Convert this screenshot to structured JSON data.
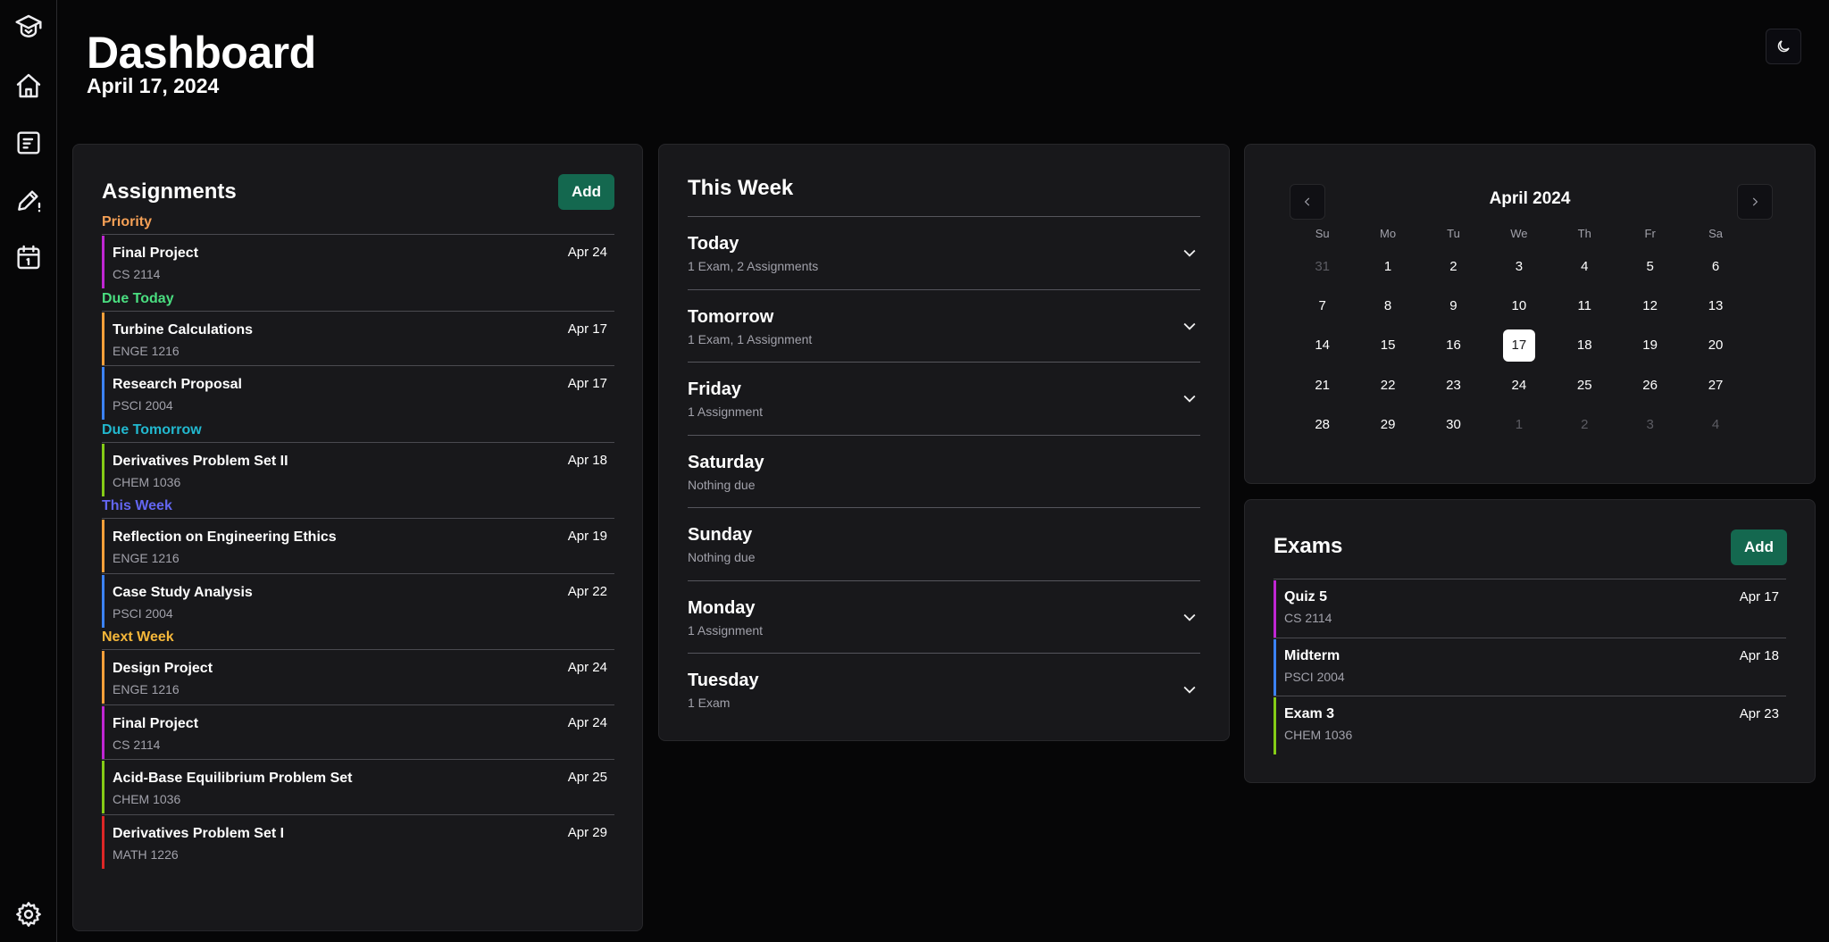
{
  "header": {
    "title": "Dashboard",
    "date": "April 17, 2024"
  },
  "sidebar": {
    "items": [
      {
        "name": "logo",
        "icon": "graduation-cap-icon"
      },
      {
        "name": "home",
        "icon": "home-icon"
      },
      {
        "name": "assignments",
        "icon": "document-list-icon"
      },
      {
        "name": "exams",
        "icon": "pencil-alert-icon"
      },
      {
        "name": "calendar",
        "icon": "calendar-icon"
      },
      {
        "name": "settings",
        "icon": "gear-icon"
      }
    ]
  },
  "theme_toggle": {
    "icon": "moon-icon"
  },
  "assignments": {
    "title": "Assignments",
    "add_label": "Add",
    "groups": [
      {
        "label": "Priority",
        "color": "#f5a056",
        "items": [
          {
            "name": "Final Project",
            "course": "CS 2114",
            "date": "Apr 24",
            "color": "#c026d3"
          }
        ]
      },
      {
        "label": "Due Today",
        "color": "#4ade80",
        "items": [
          {
            "name": "Turbine Calculations",
            "course": "ENGE 1216",
            "date": "Apr 17",
            "color": "#f5a03a"
          },
          {
            "name": "Research Proposal",
            "course": "PSCI 2004",
            "date": "Apr 17",
            "color": "#3b82f6"
          }
        ]
      },
      {
        "label": "Due Tomorrow",
        "color": "#22b8cf",
        "items": [
          {
            "name": "Derivatives Problem Set II",
            "course": "CHEM 1036",
            "date": "Apr 18",
            "color": "#84cc16"
          }
        ]
      },
      {
        "label": "This Week",
        "color": "#6366f1",
        "items": [
          {
            "name": "Reflection on Engineering Ethics",
            "course": "ENGE 1216",
            "date": "Apr 19",
            "color": "#f5a03a"
          },
          {
            "name": "Case Study Analysis",
            "course": "PSCI 2004",
            "date": "Apr 22",
            "color": "#3b82f6"
          }
        ]
      },
      {
        "label": "Next Week",
        "color": "#f5b73a",
        "items": [
          {
            "name": "Design Project",
            "course": "ENGE 1216",
            "date": "Apr 24",
            "color": "#f5a03a"
          },
          {
            "name": "Final Project",
            "course": "CS 2114",
            "date": "Apr 24",
            "color": "#c026d3"
          },
          {
            "name": "Acid-Base Equilibrium Problem Set",
            "course": "CHEM 1036",
            "date": "Apr 25",
            "color": "#84cc16"
          },
          {
            "name": "Derivatives Problem Set I",
            "course": "MATH 1226",
            "date": "Apr 29",
            "color": "#dc2626"
          }
        ]
      }
    ]
  },
  "this_week": {
    "title": "This Week",
    "days": [
      {
        "name": "Today",
        "summary": "1 Exam, 2 Assignments",
        "expandable": true
      },
      {
        "name": "Tomorrow",
        "summary": "1 Exam, 1 Assignment",
        "expandable": true
      },
      {
        "name": "Friday",
        "summary": "1 Assignment",
        "expandable": true
      },
      {
        "name": "Saturday",
        "summary": "Nothing due",
        "expandable": false
      },
      {
        "name": "Sunday",
        "summary": "Nothing due",
        "expandable": false
      },
      {
        "name": "Monday",
        "summary": "1 Assignment",
        "expandable": true
      },
      {
        "name": "Tuesday",
        "summary": "1 Exam",
        "expandable": true
      }
    ]
  },
  "calendar": {
    "month_label": "April 2024",
    "weekdays": [
      "Su",
      "Mo",
      "Tu",
      "We",
      "Th",
      "Fr",
      "Sa"
    ],
    "days": [
      {
        "d": "31",
        "muted": true
      },
      {
        "d": "1"
      },
      {
        "d": "2"
      },
      {
        "d": "3"
      },
      {
        "d": "4"
      },
      {
        "d": "5"
      },
      {
        "d": "6"
      },
      {
        "d": "7"
      },
      {
        "d": "8"
      },
      {
        "d": "9"
      },
      {
        "d": "10"
      },
      {
        "d": "11"
      },
      {
        "d": "12"
      },
      {
        "d": "13"
      },
      {
        "d": "14"
      },
      {
        "d": "15"
      },
      {
        "d": "16"
      },
      {
        "d": "17",
        "today": true
      },
      {
        "d": "18"
      },
      {
        "d": "19"
      },
      {
        "d": "20"
      },
      {
        "d": "21"
      },
      {
        "d": "22"
      },
      {
        "d": "23"
      },
      {
        "d": "24"
      },
      {
        "d": "25"
      },
      {
        "d": "26"
      },
      {
        "d": "27"
      },
      {
        "d": "28"
      },
      {
        "d": "29"
      },
      {
        "d": "30"
      },
      {
        "d": "1",
        "muted": true
      },
      {
        "d": "2",
        "muted": true
      },
      {
        "d": "3",
        "muted": true
      },
      {
        "d": "4",
        "muted": true
      }
    ]
  },
  "exams": {
    "title": "Exams",
    "add_label": "Add",
    "items": [
      {
        "name": "Quiz 5",
        "course": "CS 2114",
        "date": "Apr 17",
        "color": "#c026d3"
      },
      {
        "name": "Midterm",
        "course": "PSCI 2004",
        "date": "Apr 18",
        "color": "#3b82f6"
      },
      {
        "name": "Exam 3",
        "course": "CHEM 1036",
        "date": "Apr 23",
        "color": "#84cc16"
      }
    ]
  }
}
